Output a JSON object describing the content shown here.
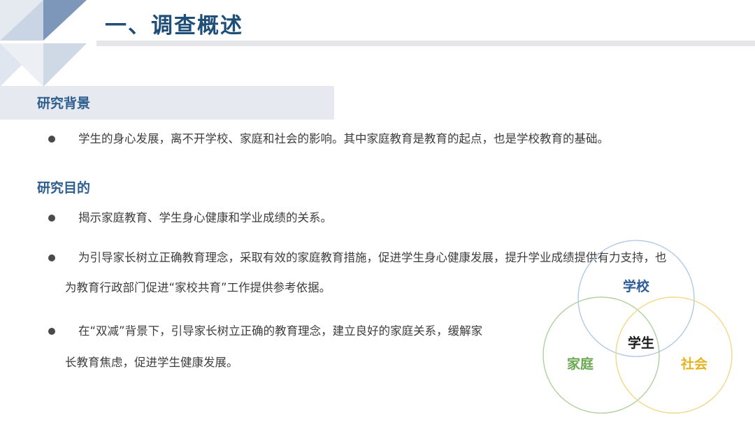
{
  "header": {
    "title": "一、调查概述"
  },
  "background": {
    "heading": "研究背景",
    "bullets": [
      {
        "lines": [
          "学生的身心发展，离不开学校、家庭和社会的影响。其中家庭教育是教育的起点，也是学校教育的基础。"
        ]
      }
    ]
  },
  "purpose": {
    "heading": "研究目的",
    "bullets": [
      {
        "lines": [
          "揭示家庭教育、学生身心健康和学业成绩的关系。"
        ]
      },
      {
        "lines": [
          "为引导家长树立正确教育理念，采取有效的家庭教育措施，促进学生身心健康发展，提升学业成绩提供有力支持，也",
          "为教育行政部门促进“家校共育”工作提供参考依据。"
        ]
      },
      {
        "lines": [
          "在“双减”背景下，引导家长树立正确的教育理念，建立良好的家庭关系，缓解家",
          "长教育焦虑，促进学生健康发展。"
        ]
      }
    ]
  },
  "venn": {
    "school": "学校",
    "family": "家庭",
    "society": "社会",
    "center": "学生",
    "colors": {
      "school": "#9dbbe0",
      "family": "#9cc38a",
      "society": "#f2cf6a",
      "school_text": "#2f5b9a",
      "family_text": "#6aa84f",
      "society_text": "#e6b422",
      "center_text": "#1a1a1a"
    }
  },
  "decoration": {
    "corner_colors": [
      "#7a95b8",
      "#c3d0e0",
      "#dfe6ee"
    ]
  }
}
